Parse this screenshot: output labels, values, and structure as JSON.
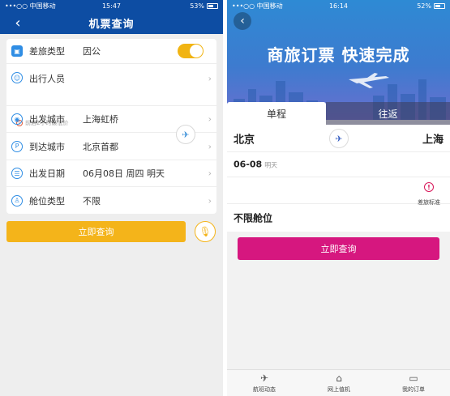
{
  "left": {
    "status": {
      "carrier": "•••○○ 中国移动",
      "time": "15:47",
      "battery": "53%"
    },
    "nav": {
      "title": "机票查询",
      "back_glyph": "‹"
    },
    "rows": [
      {
        "label": "差旅类型",
        "value": "因公"
      },
      {
        "label": "出行人员",
        "value": ""
      },
      {
        "label": "出发城市",
        "value": "上海虹桥"
      },
      {
        "label": "到达城市",
        "value": "北京首都"
      },
      {
        "label": "出发日期",
        "value": "06月08日 周四 明天"
      },
      {
        "label": "舱位类型",
        "value": "不限"
      }
    ],
    "hint": "前后2小时最低价",
    "toggle_on": true,
    "query_label": "立即查询",
    "colors": {
      "nav": "#0d4da3",
      "accent": "#f4b41a",
      "icon": "#2f8de4"
    },
    "icons": [
      "briefcase-icon",
      "person-icon",
      "location-icon",
      "pin-icon",
      "calendar-icon",
      "seat-icon",
      "plane-icon",
      "mic-icon",
      "chevron-right-icon"
    ]
  },
  "right": {
    "status": {
      "carrier": "•••○○ 中国移动",
      "time": "16:14",
      "battery": "52%"
    },
    "banner": {
      "slogan": "商旅订票  快速完成"
    },
    "tabs": [
      {
        "label": "单程",
        "active": true
      },
      {
        "label": "往返",
        "active": false
      }
    ],
    "from_city": "北京",
    "to_city": "上海",
    "date": "06-08",
    "weekday": "明天",
    "standard_label": "差旅标准",
    "cabin": "不限舱位",
    "query_label": "立即查询",
    "tabbar": [
      {
        "label": "航班动态",
        "icon": "plane-takeoff-icon"
      },
      {
        "label": "网上值机",
        "icon": "seat-icon"
      },
      {
        "label": "我的订单",
        "icon": "ticket-icon"
      }
    ],
    "colors": {
      "banner": "#2e8ad4",
      "accent": "#d6177f"
    }
  }
}
